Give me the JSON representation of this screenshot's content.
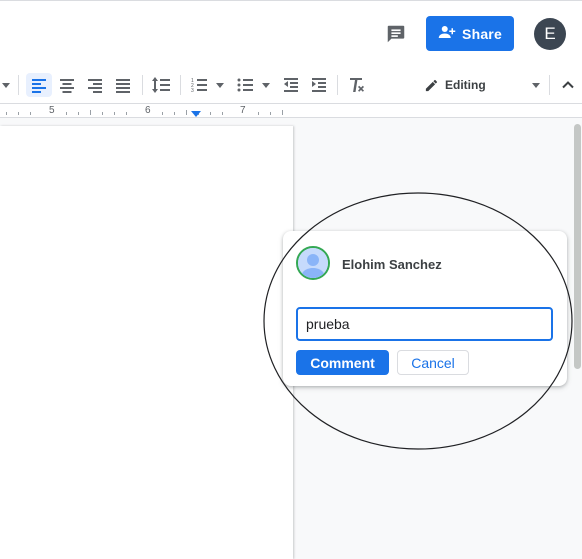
{
  "header": {
    "share_label": "Share",
    "user_initial": "E"
  },
  "toolbar": {
    "active_alignment": "left",
    "mode_label": "Editing",
    "icons": [
      "dropdown-arrow",
      "align-left",
      "align-center",
      "align-right",
      "align-justify",
      "line-spacing",
      "numbered-list",
      "bulleted-list",
      "decrease-indent",
      "increase-indent",
      "clear-formatting",
      "pencil",
      "chevron-up"
    ]
  },
  "ruler": {
    "labels": [
      "5",
      "6",
      "7"
    ]
  },
  "comment": {
    "author": "Elohim Sanchez",
    "input_value": "prueba",
    "submit_label": "Comment",
    "cancel_label": "Cancel"
  },
  "colors": {
    "accent": "#1a73e8",
    "avatar_ring": "#34a853",
    "top_avatar_bg": "#3c4652"
  }
}
